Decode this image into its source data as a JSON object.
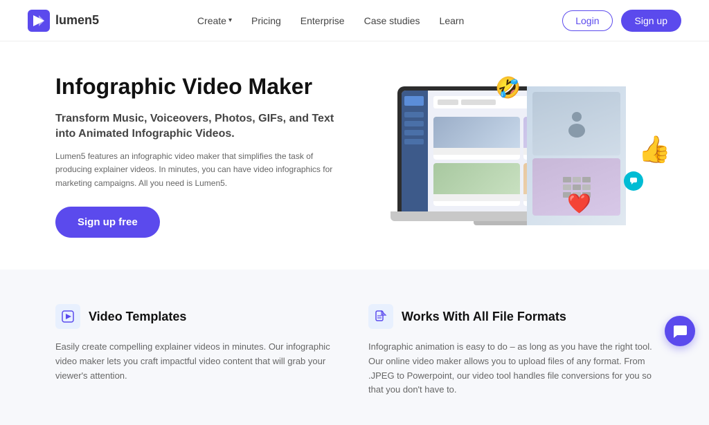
{
  "navbar": {
    "logo_text": "lumen5",
    "nav_items": [
      {
        "label": "Create",
        "has_dropdown": true
      },
      {
        "label": "Pricing"
      },
      {
        "label": "Enterprise"
      },
      {
        "label": "Case studies"
      },
      {
        "label": "Learn"
      }
    ],
    "login_label": "Login",
    "signup_label": "Sign up"
  },
  "hero": {
    "title": "Infographic Video Maker",
    "subtitle": "Transform Music, Voiceovers, Photos, GIFs, and Text into Animated Infographic Videos.",
    "description": "Lumen5 features an infographic video maker that simplifies the task of producing explainer videos. In minutes, you can have video infographics for marketing campaigns. All you need is Lumen5.",
    "cta_label": "Sign up free",
    "floats": {
      "laugh": "🤣",
      "thumb": "👍",
      "heart": "❤️",
      "teal": "💬"
    }
  },
  "features": [
    {
      "icon": "▶",
      "title": "Video Templates",
      "description": "Easily create compelling explainer videos in minutes. Our infographic video maker lets you craft impactful video content that will grab your viewer's attention."
    },
    {
      "icon": "📄",
      "title": "Works With All File Formats",
      "description": "Infographic animation is easy to do – as long as you have the right tool. Our online video maker allows you to upload files of any format. From .JPEG to Powerpoint, our video tool handles file conversions for you so that you don't have to."
    }
  ],
  "chat": {
    "icon": "💬"
  },
  "colors": {
    "primary": "#5b4aed",
    "text_dark": "#111",
    "text_mid": "#444",
    "text_light": "#666"
  }
}
